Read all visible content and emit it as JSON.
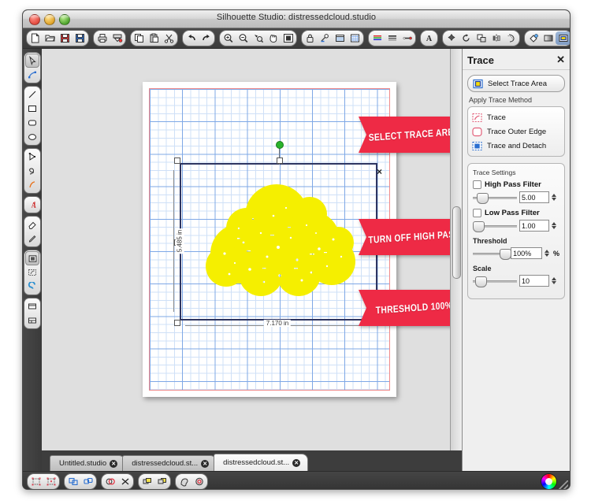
{
  "window": {
    "title": "Silhouette Studio: distressedcloud.studio",
    "traffic_lights": [
      "close",
      "minimize",
      "zoom"
    ]
  },
  "toolbar_top": {
    "groups": [
      {
        "name": "file",
        "buttons": [
          {
            "icon": "new-document-icon",
            "label": "New"
          },
          {
            "icon": "open-folder-icon",
            "label": "Open"
          },
          {
            "icon": "save-disk-icon",
            "label": "Save"
          },
          {
            "icon": "save-as-icon",
            "label": "Save As"
          }
        ]
      },
      {
        "name": "print",
        "buttons": [
          {
            "icon": "printer-icon",
            "label": "Print"
          },
          {
            "icon": "cut-page-icon",
            "label": "Send to Silhouette"
          }
        ]
      },
      {
        "name": "clipboard",
        "buttons": [
          {
            "icon": "copy-icon",
            "label": "Copy"
          },
          {
            "icon": "paste-icon",
            "label": "Paste"
          },
          {
            "icon": "scissors-icon",
            "label": "Cut"
          }
        ]
      },
      {
        "name": "history",
        "buttons": [
          {
            "icon": "undo-arrow-icon",
            "label": "Undo"
          },
          {
            "icon": "redo-arrow-icon",
            "label": "Redo"
          }
        ]
      },
      {
        "name": "zoom",
        "buttons": [
          {
            "icon": "zoom-in-icon",
            "label": "Zoom In"
          },
          {
            "icon": "zoom-out-icon",
            "label": "Zoom Out"
          },
          {
            "icon": "zoom-selection-icon",
            "label": "Zoom Selection"
          },
          {
            "icon": "pan-hand-icon",
            "label": "Pan"
          },
          {
            "icon": "fit-page-icon",
            "label": "Fit To Page"
          }
        ]
      },
      {
        "name": "document",
        "buttons": [
          {
            "icon": "lock-icon",
            "label": "Lock"
          },
          {
            "icon": "cut-settings-icon",
            "label": "Cut Settings"
          },
          {
            "icon": "page-setup-icon",
            "label": "Page Setup"
          },
          {
            "icon": "grid-settings-icon",
            "label": "Grid Settings"
          }
        ]
      },
      {
        "name": "style",
        "buttons": [
          {
            "icon": "line-color-icon",
            "label": "Line Color"
          },
          {
            "icon": "line-style-icon",
            "label": "Line Style"
          },
          {
            "icon": "line-thickness-icon",
            "label": "Line Thickness"
          }
        ]
      },
      {
        "name": "text",
        "buttons": [
          {
            "icon": "text-style-icon",
            "label": "Text Style"
          }
        ]
      },
      {
        "name": "transform",
        "buttons": [
          {
            "icon": "transform-icon",
            "label": "Transform"
          },
          {
            "icon": "rotate-icon",
            "label": "Rotate"
          },
          {
            "icon": "align-icon",
            "label": "Align"
          },
          {
            "icon": "mirror-icon",
            "label": "Mirror"
          },
          {
            "icon": "offset-icon",
            "label": "Offset"
          }
        ]
      },
      {
        "name": "fill",
        "buttons": [
          {
            "icon": "fill-color-icon",
            "label": "Fill Color"
          },
          {
            "icon": "gradient-fill-icon",
            "label": "Gradient Fill"
          },
          {
            "icon": "pattern-fill-icon",
            "label": "Pattern Fill",
            "selected": true
          }
        ]
      },
      {
        "name": "stroke",
        "buttons": [
          {
            "icon": "stroke-color-icon",
            "label": "Line Color"
          },
          {
            "icon": "sketch-pen-icon",
            "label": "Sketch Pen"
          },
          {
            "icon": "dashed-box-icon",
            "label": "Registration Marks"
          },
          {
            "icon": "grid-icon",
            "label": "Grid"
          }
        ]
      }
    ]
  },
  "toolbar_left": {
    "groups": [
      {
        "name": "select",
        "tools": [
          {
            "icon": "select-arrow-icon",
            "label": "Select",
            "selected": true
          },
          {
            "icon": "edit-points-icon",
            "label": "Edit Points"
          }
        ]
      },
      {
        "name": "shapes",
        "tools": [
          {
            "icon": "line-tool-icon",
            "label": "Draw a Line"
          },
          {
            "icon": "rectangle-tool-icon",
            "label": "Draw a Rectangle"
          },
          {
            "icon": "rounded-rect-tool-icon",
            "label": "Draw a Rounded Rectangle"
          },
          {
            "icon": "ellipse-tool-icon",
            "label": "Draw an Ellipse"
          }
        ]
      },
      {
        "name": "draw",
        "tools": [
          {
            "icon": "polygon-tool-icon",
            "label": "Draw a Polygon"
          },
          {
            "icon": "curve-tool-icon",
            "label": "Draw a Curve Shape"
          },
          {
            "icon": "freehand-tool-icon",
            "label": "Draw Freehand"
          }
        ]
      },
      {
        "name": "text",
        "tools": [
          {
            "icon": "text-tool-icon",
            "label": "Draw a Text Area"
          }
        ]
      },
      {
        "name": "edit",
        "tools": [
          {
            "icon": "eraser-tool-icon",
            "label": "Eraser"
          },
          {
            "icon": "knife-tool-icon",
            "label": "Knife"
          }
        ]
      },
      {
        "name": "modify",
        "tools": [
          {
            "icon": "offset-tool-icon",
            "label": "Offset"
          },
          {
            "icon": "trace-tool-icon",
            "label": "Trace",
            "selected": true
          },
          {
            "icon": "sketch-tool-icon",
            "label": "Sketch"
          }
        ]
      },
      {
        "name": "pages",
        "tools": [
          {
            "icon": "page-tool-icon",
            "label": "Page Setup"
          },
          {
            "icon": "layers-tool-icon",
            "label": "Layers"
          }
        ]
      }
    ]
  },
  "canvas": {
    "selection": {
      "width_label": "7.170 in",
      "height_label": "5.485 in",
      "rotate_handle": "rotate-handle",
      "close_marker": "×"
    },
    "artwork": {
      "name": "distressed-cloud-graphic",
      "fill_color": "#f5ef00"
    },
    "page_border_color": "#f08a8a",
    "grid_minor_color": "#cfe0f7",
    "grid_major_color": "#7fa8e6"
  },
  "annotations": {
    "color": "#ee2a45",
    "banners": [
      {
        "name": "banner-select-trace-area",
        "text": "SELECT TRACE AREA"
      },
      {
        "name": "banner-turn-off-high-pass",
        "text": "TURN OFF HIGH PASS"
      },
      {
        "name": "banner-threshold",
        "text": "THRESHOLD 100%"
      }
    ]
  },
  "panel": {
    "title": "Trace",
    "close_label": "✕",
    "select_trace_area": {
      "label": "Select Trace Area",
      "icon": "trace-area-icon"
    },
    "method_section_label": "Apply Trace Method",
    "methods": [
      {
        "label": "Trace",
        "icon": "trace-icon"
      },
      {
        "label": "Trace Outer Edge",
        "icon": "trace-outer-edge-icon"
      },
      {
        "label": "Trace and Detach",
        "icon": "trace-and-detach-icon"
      }
    ],
    "settings": {
      "section_label": "Trace Settings",
      "high_pass_filter": {
        "label": "High Pass Filter",
        "checked": false,
        "value": "5.00",
        "slider_pct": 12
      },
      "low_pass_filter": {
        "label": "Low Pass Filter",
        "checked": false,
        "value": "1.00",
        "slider_pct": 3
      },
      "threshold": {
        "label": "Threshold",
        "value": "100%",
        "unit": "%",
        "slider_pct": 86
      },
      "scale": {
        "label": "Scale",
        "value": "10",
        "slider_pct": 8
      }
    }
  },
  "tabs": [
    {
      "label": "Untitled.studio",
      "active": false
    },
    {
      "label": "distressedcloud.st...",
      "active": false
    },
    {
      "label": "distressedcloud.st...",
      "active": true
    }
  ],
  "toolbar_bottom": {
    "groups": [
      {
        "name": "grouping",
        "buttons": [
          {
            "icon": "group-icon",
            "label": "Group"
          },
          {
            "icon": "ungroup-icon",
            "label": "Ungroup"
          }
        ]
      },
      {
        "name": "compound",
        "buttons": [
          {
            "icon": "make-compound-path-icon",
            "label": "Make Compound Path"
          },
          {
            "icon": "release-compound-path-icon",
            "label": "Release Compound Path"
          }
        ]
      },
      {
        "name": "weld",
        "buttons": [
          {
            "icon": "weld-icon",
            "label": "Weld"
          },
          {
            "icon": "subtract-icon",
            "label": "Subtract"
          }
        ]
      },
      {
        "name": "arrange",
        "buttons": [
          {
            "icon": "bring-forward-icon",
            "label": "Bring Forward"
          },
          {
            "icon": "send-backward-icon",
            "label": "Send Backward"
          }
        ]
      },
      {
        "name": "misc",
        "buttons": [
          {
            "icon": "fill-shape-icon",
            "label": "Fill"
          },
          {
            "icon": "cut-style-icon",
            "label": "Cut Style"
          }
        ]
      }
    ],
    "color_wheel": "color-wheel-icon"
  }
}
